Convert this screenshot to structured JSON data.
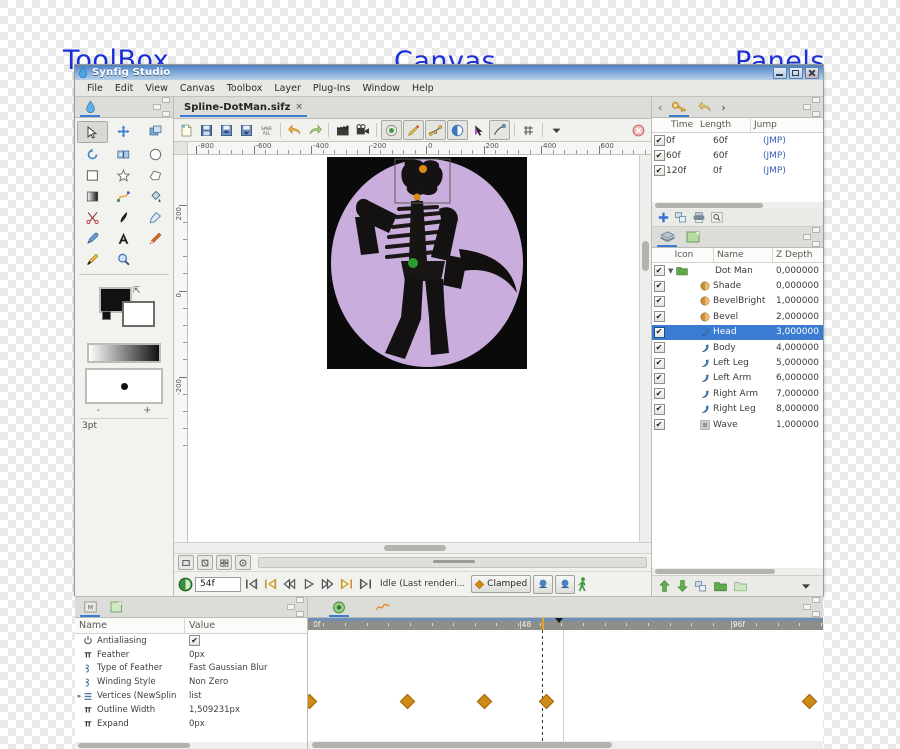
{
  "annotations": {
    "toolbox": "ToolBox",
    "canvas": "Canvas",
    "panels_right": "Panels",
    "panels_bottom": "Panels"
  },
  "window": {
    "title": "Synfig Studio",
    "icon": "droplet-icon",
    "controls": [
      "minimize",
      "maximize",
      "close"
    ]
  },
  "menubar": {
    "items": [
      "File",
      "Edit",
      "View",
      "Canvas",
      "Toolbox",
      "Layer",
      "Plug-Ins",
      "Window",
      "Help"
    ]
  },
  "toolbox": {
    "tab_icon": "droplet-icon",
    "tools": [
      {
        "name": "transform-tool",
        "selected": true
      },
      {
        "name": "smooth-move-tool",
        "selected": false
      },
      {
        "name": "scale-tool",
        "selected": false
      },
      {
        "name": "rotate-tool",
        "selected": false
      },
      {
        "name": "mirror-tool",
        "selected": false
      },
      {
        "name": "circle-tool",
        "selected": false
      },
      {
        "name": "rectangle-tool",
        "selected": false
      },
      {
        "name": "star-tool",
        "selected": false
      },
      {
        "name": "polygon-tool",
        "selected": false
      },
      {
        "name": "gradient-tool",
        "selected": false
      },
      {
        "name": "spline-tool",
        "selected": false
      },
      {
        "name": "fill-tool",
        "selected": false
      },
      {
        "name": "cutout-tool",
        "selected": false
      },
      {
        "name": "draw-tool",
        "selected": false
      },
      {
        "name": "sketch-tool",
        "selected": false
      },
      {
        "name": "eyedropper-tool",
        "selected": false
      },
      {
        "name": "text-tool",
        "selected": false
      },
      {
        "name": "width-tool",
        "selected": false
      },
      {
        "name": "brush-tool",
        "selected": false
      },
      {
        "name": "zoom-tool",
        "selected": false
      }
    ],
    "fill_color": "#111111",
    "outline_color": "#ffffff",
    "brush_size_label": "3pt",
    "stepper": {
      "minus": "-",
      "plus": "+"
    }
  },
  "canvas": {
    "tab_label": "Spline-DotMan.sifz",
    "tab_close": "×",
    "toolbar": [
      {
        "name": "new-file-button"
      },
      {
        "name": "save-file-button"
      },
      {
        "name": "save-as-button"
      },
      {
        "name": "save-all-button"
      },
      {
        "name": "save-all-text-button",
        "label": "SAVE ALL"
      },
      {
        "name": "undo-button"
      },
      {
        "name": "redo-button"
      },
      {
        "name": "render-button"
      },
      {
        "name": "preview-button"
      },
      {
        "name": "show-grid-toggle"
      },
      {
        "name": "snap-toggle"
      },
      {
        "name": "low-res-toggle"
      },
      {
        "name": "onion-skin-toggle"
      },
      {
        "name": "background-rendering-toggle"
      },
      {
        "name": "refresh-button"
      },
      {
        "name": "grid-button"
      },
      {
        "name": "menu-caret-button"
      },
      {
        "name": "close-canvas-button"
      }
    ],
    "hruler_labels": [
      "-800",
      "-600",
      "-400",
      "-200",
      "0",
      "200",
      "400",
      "600"
    ],
    "vruler_labels": [
      "200",
      "0",
      "-200"
    ]
  },
  "playbar": {
    "current_time": "54f",
    "status": "Idle (Last renderi...",
    "interpolation": "Clamped",
    "buttons": [
      {
        "name": "seek-begin-button"
      },
      {
        "name": "seek-prev-keyframe-button"
      },
      {
        "name": "seek-prev-frame-button"
      },
      {
        "name": "play-button"
      },
      {
        "name": "seek-next-frame-button"
      },
      {
        "name": "seek-next-keyframe-button"
      },
      {
        "name": "seek-end-button"
      }
    ],
    "toggles": [
      "render-in-background",
      "render-preview",
      "show-animation-mode"
    ]
  },
  "keyframes": {
    "tabs": [
      {
        "name": "keyframes-tab",
        "icon": "key-icon",
        "active": true
      },
      {
        "name": "history-tab",
        "icon": "undo-icon",
        "active": false
      }
    ],
    "nav": {
      "prev": "‹",
      "next": "›"
    },
    "columns": [
      "Time",
      "Length",
      "Jump"
    ],
    "rows": [
      {
        "enabled": true,
        "time": "0f",
        "length": "60f",
        "jump": "(JMP)"
      },
      {
        "enabled": true,
        "time": "60f",
        "length": "60f",
        "jump": "(JMP)"
      },
      {
        "enabled": true,
        "time": "120f",
        "length": "0f",
        "jump": "(JMP)"
      }
    ],
    "tools": [
      "add-keyframe",
      "duplicate-keyframe",
      "remove-keyframe",
      "find-keyframe"
    ]
  },
  "layers": {
    "tabs": [
      {
        "name": "layers-tab",
        "icon": "layers-icon",
        "active": true
      },
      {
        "name": "canvas-browser-tab",
        "icon": "canvas-icon",
        "active": false
      }
    ],
    "columns": [
      "Icon",
      "Name",
      "Z Depth"
    ],
    "rows": [
      {
        "enabled": true,
        "name": "Dot Man",
        "z": "0,000000",
        "icon": "group-icon",
        "indent": 0,
        "expanded": true,
        "selected": false
      },
      {
        "enabled": true,
        "name": "Shade",
        "z": "0,000000",
        "icon": "shade-icon",
        "indent": 1,
        "selected": false
      },
      {
        "enabled": true,
        "name": "BevelBright",
        "z": "1,000000",
        "icon": "bevel-icon",
        "indent": 1,
        "selected": false
      },
      {
        "enabled": true,
        "name": "Bevel",
        "z": "2,000000",
        "icon": "bevel-icon",
        "indent": 1,
        "selected": false
      },
      {
        "enabled": true,
        "name": "Head",
        "z": "3,000000",
        "icon": "spline-icon",
        "indent": 1,
        "selected": true
      },
      {
        "enabled": true,
        "name": "Body",
        "z": "4,000000",
        "icon": "spline-icon",
        "indent": 1,
        "selected": false
      },
      {
        "enabled": true,
        "name": "Left Leg",
        "z": "5,000000",
        "icon": "spline-icon",
        "indent": 1,
        "selected": false
      },
      {
        "enabled": true,
        "name": "Left Arm",
        "z": "6,000000",
        "icon": "spline-icon",
        "indent": 1,
        "selected": false
      },
      {
        "enabled": true,
        "name": "Right Arm",
        "z": "7,000000",
        "icon": "spline-icon",
        "indent": 1,
        "selected": false
      },
      {
        "enabled": true,
        "name": "Right Leg",
        "z": "8,000000",
        "icon": "spline-icon",
        "indent": 1,
        "selected": false
      },
      {
        "enabled": true,
        "name": "Wave",
        "z": "1,000000",
        "icon": "noise-icon",
        "indent": 1,
        "selected": false
      }
    ],
    "bottom_tools": [
      "raise-layer",
      "lower-layer",
      "duplicate-layer",
      "group-layer",
      "ungroup-layer",
      "layer-menu-caret"
    ]
  },
  "params": {
    "tabs": [
      {
        "name": "params-tab",
        "icon": "params-icon",
        "active": true
      },
      {
        "name": "children-tab",
        "icon": "children-icon",
        "active": false
      }
    ],
    "columns": [
      "Name",
      "Value"
    ],
    "rows": [
      {
        "icon": "power-icon",
        "name": "Antialiasing",
        "value": "✔",
        "value_is_check": true,
        "expandable": false
      },
      {
        "icon": "pi-icon",
        "name": "Feather",
        "value": "0px",
        "expandable": false
      },
      {
        "icon": "enum-icon",
        "name": "Type of Feather",
        "value": "Fast Gaussian Blur",
        "expandable": false
      },
      {
        "icon": "enum-icon",
        "name": "Winding Style",
        "value": "Non Zero",
        "expandable": false
      },
      {
        "icon": "list-icon",
        "name": "Vertices (NewSplin",
        "value": "list",
        "expandable": true
      },
      {
        "icon": "pi-icon",
        "name": "Outline Width",
        "value": "1,509231px",
        "expandable": false
      },
      {
        "icon": "pi-icon",
        "name": "Expand",
        "value": "0px",
        "expandable": false
      }
    ]
  },
  "timetrack": {
    "tabs": [
      {
        "name": "timetrack-tab",
        "icon": "timetrack-icon",
        "active": true
      },
      {
        "name": "curves-tab",
        "icon": "curves-icon",
        "active": false
      }
    ],
    "ruler_labels": [
      "0f",
      "48",
      "96f"
    ],
    "current_time_marker": "54f",
    "waypoints": [
      {
        "frame": 0,
        "x_pct": 0
      },
      {
        "frame": 18,
        "x_pct": 19
      },
      {
        "frame": 33,
        "x_pct": 34
      },
      {
        "frame": 46,
        "x_pct": 46
      },
      {
        "frame": 120,
        "x_pct": 97
      }
    ]
  },
  "colors": {
    "accent": "#3b7cd3",
    "waypoint": "#d08a16",
    "title_blue": "#4f7fbf",
    "annotation": "#1a2ed8",
    "canvas_bg": "#c9aedd"
  }
}
